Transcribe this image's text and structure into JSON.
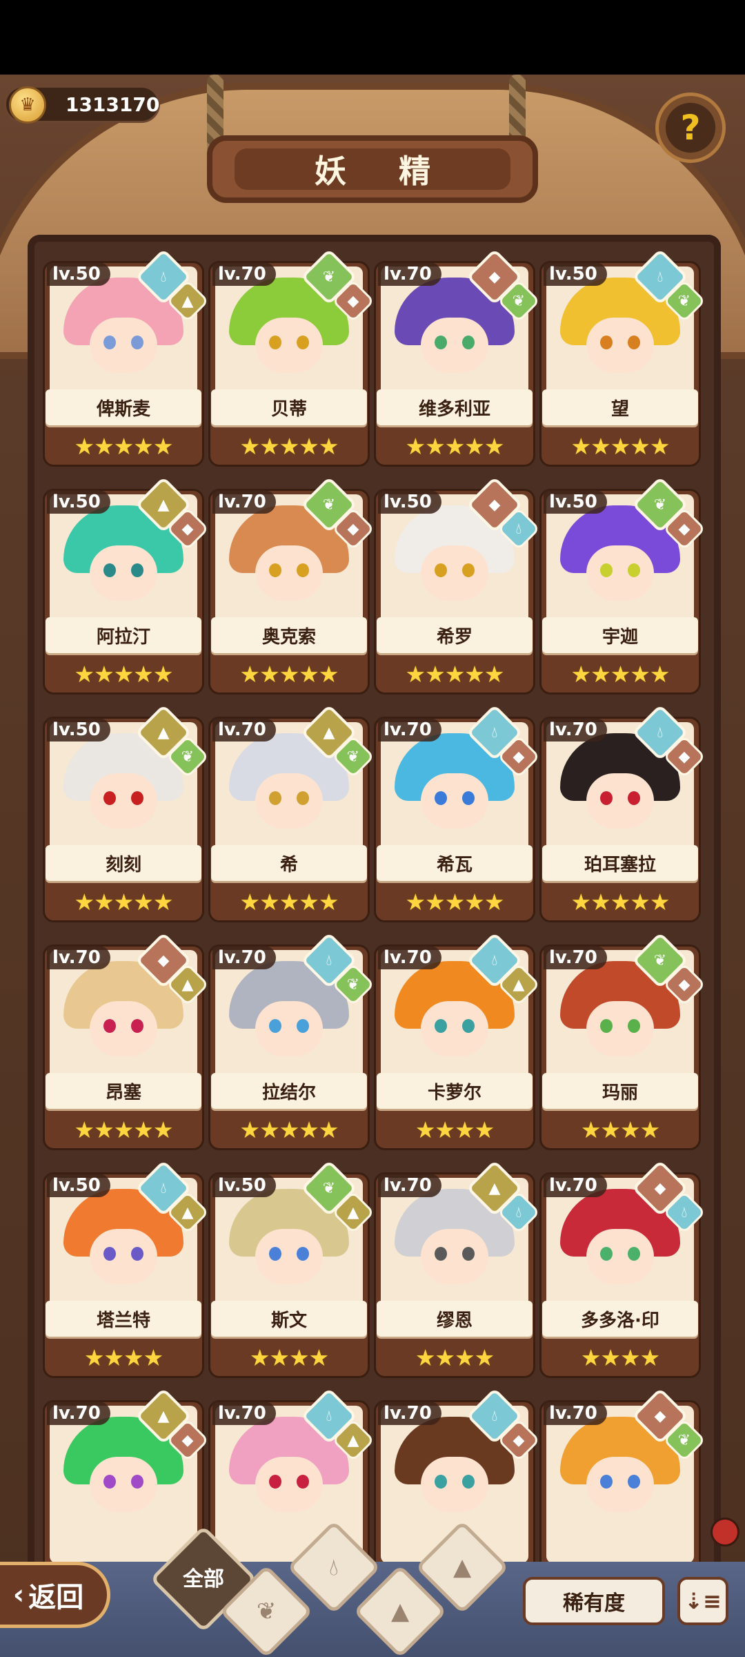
{
  "header": {
    "title": "妖 精",
    "coins": "1313170"
  },
  "bottom": {
    "back_label": "返回",
    "back_glyph": "‹",
    "filter_all_label": "全部",
    "rarity_label": "稀有度",
    "sort_glyph": "⇣≡"
  },
  "fairies": [
    {
      "name": "俾斯麦",
      "level": "lv.50",
      "elem1": "water",
      "elem2": "earth",
      "stars": 5,
      "hair": "#f4a3b4",
      "eye": "#7a9ad8"
    },
    {
      "name": "贝蒂",
      "level": "lv.70",
      "elem1": "plant",
      "elem2": "fire",
      "stars": 5,
      "hair": "#8ccb3a",
      "eye": "#d8a020"
    },
    {
      "name": "维多利亚",
      "level": "lv.70",
      "elem1": "fire",
      "elem2": "plant",
      "stars": 5,
      "hair": "#6a4ab4",
      "eye": "#4aaa6a"
    },
    {
      "name": "望",
      "level": "lv.50",
      "elem1": "water",
      "elem2": "plant",
      "stars": 5,
      "hair": "#f0c030",
      "eye": "#d88020"
    },
    {
      "name": "阿拉汀",
      "level": "lv.50",
      "elem1": "earth",
      "elem2": "fire",
      "stars": 5,
      "hair": "#3ac8a8",
      "eye": "#2a8a8a"
    },
    {
      "name": "奥克索",
      "level": "lv.70",
      "elem1": "plant",
      "elem2": "fire",
      "stars": 5,
      "hair": "#d88a50",
      "eye": "#d8a020"
    },
    {
      "name": "希罗",
      "level": "lv.50",
      "elem1": "fire",
      "elem2": "water",
      "stars": 5,
      "hair": "#f0ece8",
      "eye": "#d8a020"
    },
    {
      "name": "宇迦",
      "level": "lv.50",
      "elem1": "plant",
      "elem2": "fire",
      "stars": 5,
      "hair": "#7a4ad8",
      "eye": "#c8d030"
    },
    {
      "name": "刻刻",
      "level": "lv.50",
      "elem1": "earth",
      "elem2": "plant",
      "stars": 5,
      "hair": "#eae6e2",
      "eye": "#c82020"
    },
    {
      "name": "希",
      "level": "lv.70",
      "elem1": "earth",
      "elem2": "plant",
      "stars": 5,
      "hair": "#d8dae4",
      "eye": "#d0a030"
    },
    {
      "name": "希瓦",
      "level": "lv.70",
      "elem1": "water",
      "elem2": "fire",
      "stars": 5,
      "hair": "#4ab8e0",
      "eye": "#3a7ad8"
    },
    {
      "name": "珀耳塞拉",
      "level": "lv.70",
      "elem1": "water",
      "elem2": "fire",
      "stars": 5,
      "hair": "#2a2020",
      "eye": "#c82030"
    },
    {
      "name": "昂塞",
      "level": "lv.70",
      "elem1": "fire",
      "elem2": "earth",
      "stars": 5,
      "hair": "#e8c890",
      "eye": "#c82050"
    },
    {
      "name": "拉结尔",
      "level": "lv.70",
      "elem1": "water",
      "elem2": "plant",
      "stars": 5,
      "hair": "#b0b4c0",
      "eye": "#4aa0d8"
    },
    {
      "name": "卡萝尔",
      "level": "lv.70",
      "elem1": "water",
      "elem2": "earth",
      "stars": 4,
      "hair": "#f08a20",
      "eye": "#3aa0a0"
    },
    {
      "name": "玛丽",
      "level": "lv.70",
      "elem1": "plant",
      "elem2": "fire",
      "stars": 4,
      "hair": "#c04a2a",
      "eye": "#5ab04a"
    },
    {
      "name": "塔兰特",
      "level": "lv.50",
      "elem1": "water",
      "elem2": "earth",
      "stars": 4,
      "hair": "#f07a30",
      "eye": "#6a5ac8"
    },
    {
      "name": "斯文",
      "level": "lv.50",
      "elem1": "plant",
      "elem2": "earth",
      "stars": 4,
      "hair": "#d8c890",
      "eye": "#4a80d8"
    },
    {
      "name": "缪恩",
      "level": "lv.70",
      "elem1": "earth",
      "elem2": "water",
      "stars": 4,
      "hair": "#d0d0d4",
      "eye": "#5a5a5a"
    },
    {
      "name": "多多洛·印",
      "level": "lv.70",
      "elem1": "fire",
      "elem2": "water",
      "stars": 4,
      "hair": "#c82a3a",
      "eye": "#4ab06a"
    },
    {
      "name": "",
      "level": "lv.70",
      "elem1": "earth",
      "elem2": "fire",
      "stars": 0,
      "hair": "#3ac860",
      "eye": "#a04ac8"
    },
    {
      "name": "",
      "level": "lv.70",
      "elem1": "water",
      "elem2": "earth",
      "stars": 0,
      "hair": "#f0a0c0",
      "eye": "#c82040"
    },
    {
      "name": "",
      "level": "lv.70",
      "elem1": "water",
      "elem2": "fire",
      "stars": 0,
      "hair": "#6a3a20",
      "eye": "#3aa0a0"
    },
    {
      "name": "",
      "level": "lv.70",
      "elem1": "fire",
      "elem2": "plant",
      "stars": 0,
      "hair": "#f0a030",
      "eye": "#4a80d8"
    }
  ]
}
